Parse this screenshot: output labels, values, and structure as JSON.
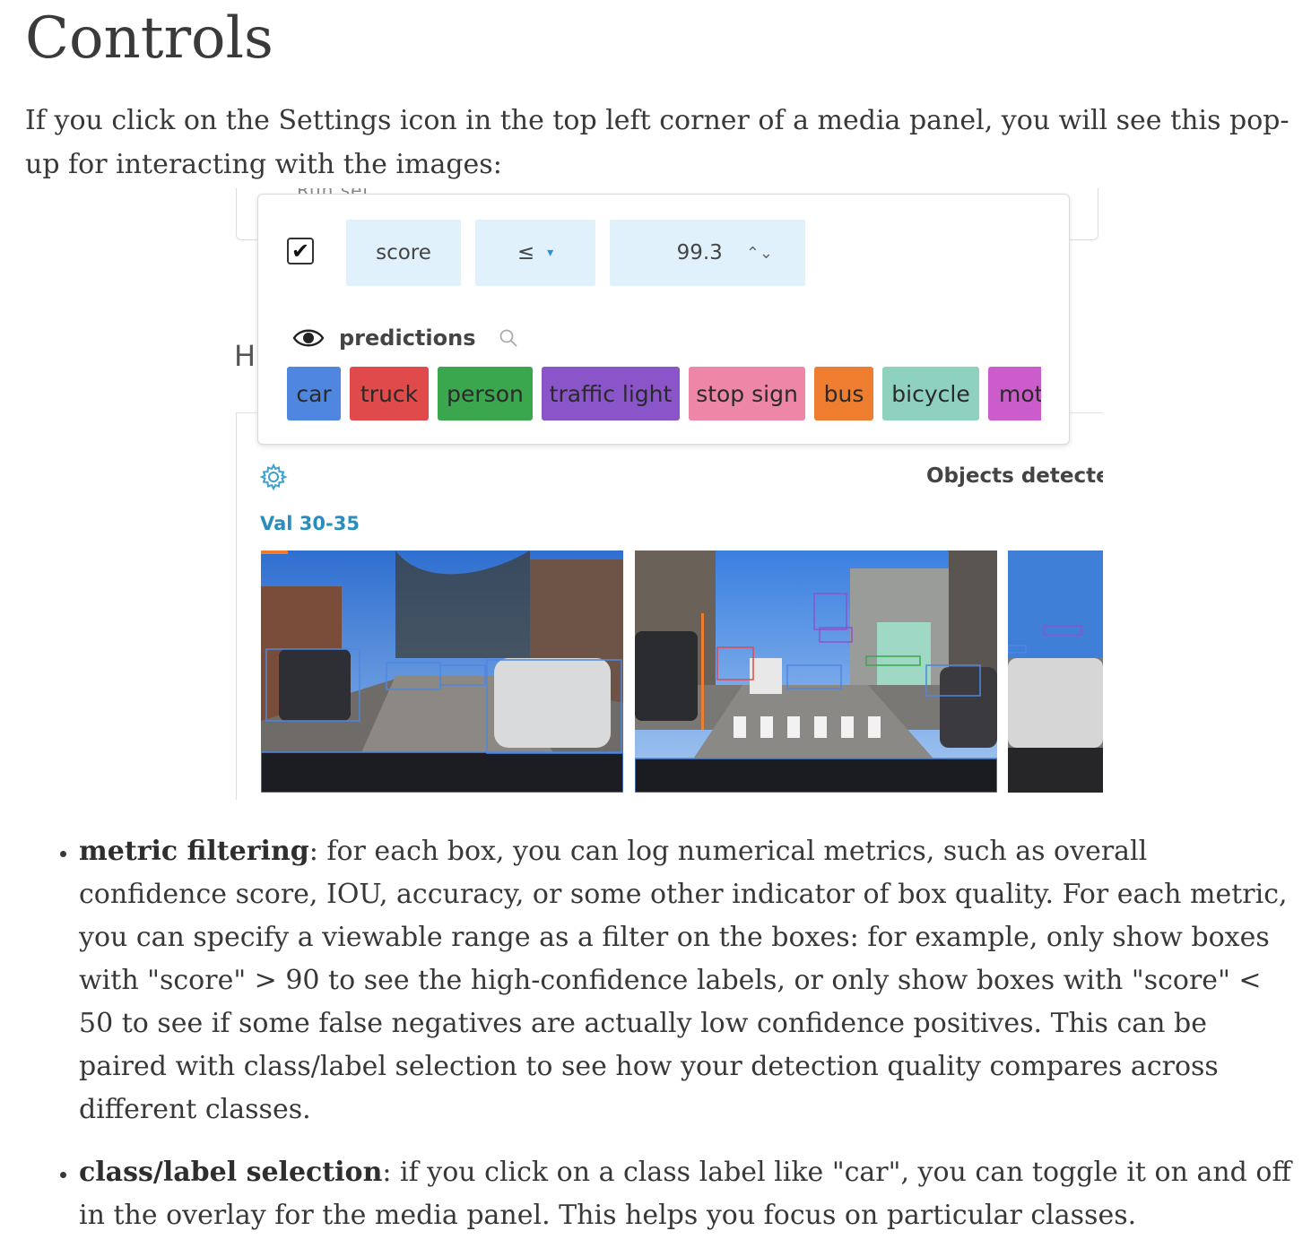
{
  "heading": "Controls",
  "intro": "If you click on the Settings icon in the top left corner of a media panel, you will see this pop-up for interacting with the images:",
  "screenshot": {
    "background_partial_text": "Run set",
    "background_partial_heading": "H",
    "filter": {
      "enabled": true,
      "checkbox_glyph": "✔",
      "metric": "score",
      "operator": "≤",
      "operator_caret": "▾",
      "value": "99.3",
      "stepper_glyph": "⌃⌄"
    },
    "predictions_label": "predictions",
    "icons": [
      "eye-icon",
      "search-icon",
      "gear-icon"
    ],
    "class_chips": [
      {
        "label": "car",
        "color": "#4f86e0"
      },
      {
        "label": "truck",
        "color": "#e04a4a"
      },
      {
        "label": "person",
        "color": "#3aa64e"
      },
      {
        "label": "traffic light",
        "color": "#8a55c8"
      },
      {
        "label": "stop sign",
        "color": "#ee86a8"
      },
      {
        "label": "bus",
        "color": "#ee7d2f"
      },
      {
        "label": "bicycle",
        "color": "#8fd1bf"
      },
      {
        "label": "mot",
        "color": "#cc5ccc"
      }
    ],
    "panel_title": "Objects detected",
    "run_label": "Val 30-35"
  },
  "bullets": [
    {
      "term": "metric filtering",
      "text": ": for each box, you can log numerical metrics, such as overall confidence score, IOU, accuracy, or some other indicator of box quality. For each metric, you can specify a viewable range as a filter on the boxes: for example, only show boxes with \"score\" > 90 to see the high-confidence labels, or only show boxes with \"score\" < 50 to see if some false negatives are actually low confidence positives. This can be paired with class/label selection to see how your detection quality compares across different classes."
    },
    {
      "term": "class/label selection",
      "text": ": if you click on a class label like \"car\", you can toggle it on and off in the overlay for the media panel. This helps you focus on particular classes."
    }
  ]
}
